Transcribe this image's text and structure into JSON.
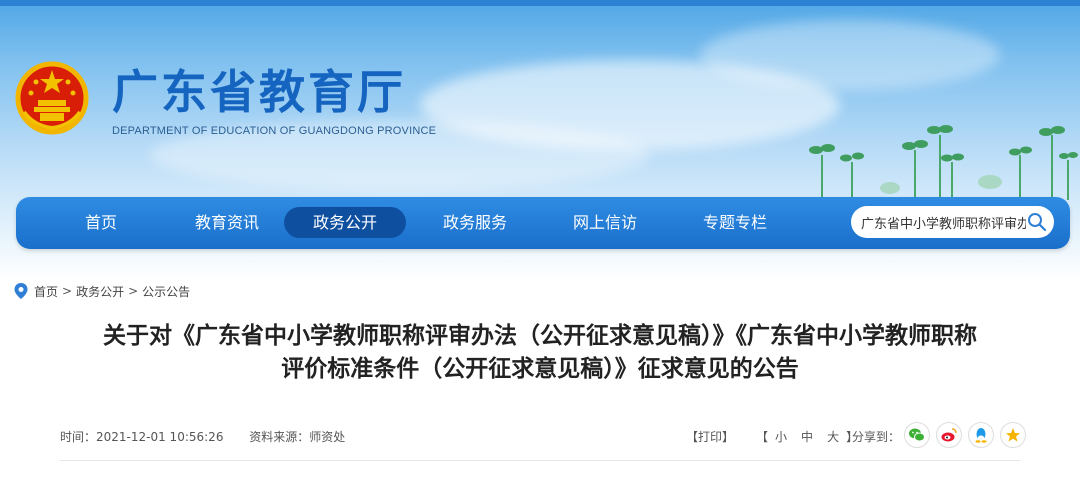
{
  "site": {
    "title": "广东省教育厅",
    "subtitle": "DEPARTMENT OF EDUCATION OF GUANGDONG PROVINCE"
  },
  "nav": {
    "items": [
      {
        "label": "首页"
      },
      {
        "label": "教育资讯"
      },
      {
        "label": "政务公开",
        "active": true
      },
      {
        "label": "政务服务"
      },
      {
        "label": "网上信访"
      },
      {
        "label": "专题专栏"
      }
    ],
    "search_value": "广东省中小学教师职称评审办"
  },
  "breadcrumb": {
    "items": [
      "首页",
      "政务公开",
      "公示公告"
    ],
    "separator": ">"
  },
  "article": {
    "title_line1": "关于对《广东省中小学教师职称评审办法（公开征求意见稿）》《广东省中小学教师职称",
    "title_line2": "评价标准条件（公开征求意见稿）》征求意见的公告",
    "time_text": "时间：2021-12-01 10:56:26",
    "source_text": "资料来源：师资处"
  },
  "tools": {
    "print": "【打印】",
    "size_open": "【",
    "size_small": "小",
    "size_medium": "中",
    "size_large": "大",
    "size_close": "】",
    "share_label": "分享到：",
    "share_icons": [
      "wechat-icon",
      "weibo-icon",
      "qq-icon",
      "qzone-icon"
    ]
  },
  "colors": {
    "brand_blue": "#1565c0",
    "nav_blue": "#1a6fcb",
    "nav_active": "#0e4fa0",
    "wechat": "#3cb034",
    "weibo": "#e6162d",
    "qq": "#1e9be8",
    "qzone": "#f5b400"
  }
}
